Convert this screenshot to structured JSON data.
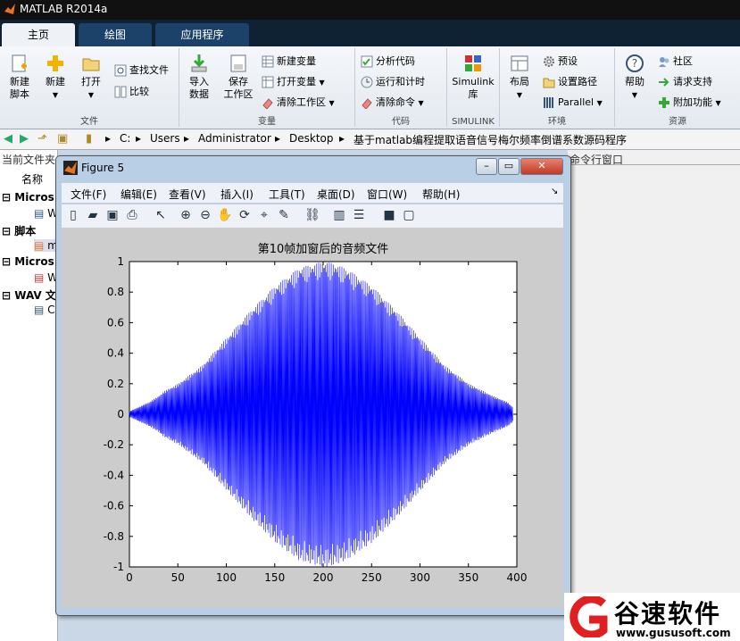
{
  "window": {
    "title": "MATLAB R2014a"
  },
  "tabs": [
    {
      "label": "主页"
    },
    {
      "label": "绘图"
    },
    {
      "label": "应用程序"
    }
  ],
  "ribbon": {
    "groups": [
      {
        "label": "文件"
      },
      {
        "label": "变量"
      },
      {
        "label": "代码"
      },
      {
        "label": "SIMULINK"
      },
      {
        "label": "环境"
      },
      {
        "label": "资源"
      }
    ],
    "new_script": "新建\n脚本",
    "new": "新建",
    "open": "打开",
    "find_files": "查找文件",
    "compare": "比较",
    "import_data": "导入\n数据",
    "save_workspace": "保存\n工作区",
    "new_variable": "新建变量",
    "open_variable": "打开变量",
    "clear_workspace": "清除工作区",
    "analyze_code": "分析代码",
    "run_and_time": "运行和计时",
    "clear_commands": "清除命令",
    "simulink_library": "Simulink\n库",
    "layout": "布局",
    "preferences": "预设",
    "set_path": "设置路径",
    "parallel": "Parallel",
    "help": "帮助",
    "community": "社区",
    "request_support": "请求支持",
    "add_ons": "附加功能"
  },
  "address": {
    "crumbs": [
      "C:",
      "Users",
      "Administrator",
      "Desktop",
      "基于matlab编程提取语音信号梅尔频率倒谱系数源码程序"
    ]
  },
  "left_panel": {
    "header": "当前文件夹",
    "name_col": "名称",
    "items": [
      {
        "label": "Micros"
      },
      {
        "label": "W"
      },
      {
        "label": "脚本"
      },
      {
        "label": "m"
      },
      {
        "label": "Micros"
      },
      {
        "label": "W"
      },
      {
        "label": "WAV 文"
      },
      {
        "label": "C"
      }
    ]
  },
  "right_strip": {
    "header": "命令行窗口"
  },
  "figure": {
    "title": "Figure 5",
    "menus": [
      "文件(F)",
      "编辑(E)",
      "查看(V)",
      "插入(I)",
      "工具(T)",
      "桌面(D)",
      "窗口(W)",
      "帮助(H)"
    ],
    "toolbar_icons": [
      "new-figure-icon",
      "open-icon",
      "save-icon",
      "print-icon",
      "pointer-icon",
      "zoom-in-icon",
      "zoom-out-icon",
      "pan-icon",
      "rotate-icon",
      "data-cursor-icon",
      "brush-icon",
      "link-icon",
      "colorbar-icon",
      "legend-icon",
      "hide-plot-tools-icon",
      "show-plot-tools-icon"
    ]
  },
  "chart_data": {
    "type": "line",
    "title": "第10帧加窗后的音频文件",
    "xlabel": "",
    "ylabel": "",
    "xlim": [
      0,
      400
    ],
    "ylim": [
      -1,
      1
    ],
    "xticks": [
      0,
      50,
      100,
      150,
      200,
      250,
      300,
      350,
      400
    ],
    "yticks": [
      -1,
      -0.8,
      -0.6,
      -0.4,
      -0.2,
      0,
      0.2,
      0.4,
      0.6,
      0.8,
      1
    ],
    "series": [
      {
        "color": "#0000ff",
        "envelope_x": [
          0,
          10,
          20,
          30,
          35,
          50,
          75,
          100,
          125,
          150,
          175,
          200,
          210,
          225,
          250,
          275,
          300,
          325,
          350,
          375,
          390,
          395
        ],
        "envelope_y": [
          0.02,
          0.05,
          0.08,
          0.12,
          0.15,
          0.2,
          0.32,
          0.5,
          0.68,
          0.84,
          0.96,
          1.0,
          0.99,
          0.95,
          0.84,
          0.68,
          0.5,
          0.32,
          0.2,
          0.12,
          0.08,
          0.05
        ]
      }
    ]
  },
  "watermark": {
    "brand": "谷速软件",
    "url": "www.gususoft.com"
  }
}
